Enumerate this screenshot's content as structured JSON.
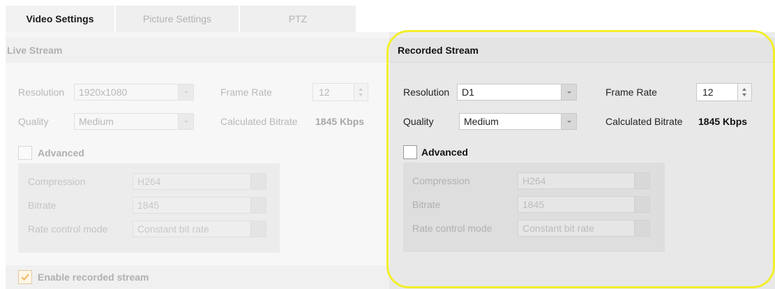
{
  "tabs": [
    {
      "label": "Video Settings",
      "active": true
    },
    {
      "label": "Picture Settings",
      "active": false
    },
    {
      "label": "PTZ",
      "active": false
    }
  ],
  "live_stream": {
    "title": "Live Stream",
    "resolution_label": "Resolution",
    "resolution_value": "1920x1080",
    "frame_rate_label": "Frame Rate",
    "frame_rate_value": "12",
    "quality_label": "Quality",
    "quality_value": "Medium",
    "calc_bitrate_label": "Calculated Bitrate",
    "calc_bitrate_value": "1845 Kbps",
    "advanced_label": "Advanced",
    "compression_label": "Compression",
    "compression_value": "H264",
    "bitrate_label": "Bitrate",
    "bitrate_value": "1845",
    "rate_control_label": "Rate control mode",
    "rate_control_value": "Constant bit rate",
    "enable_recorded_label": "Enable recorded stream",
    "enable_recorded_checked": true
  },
  "recorded_stream": {
    "title": "Recorded Stream",
    "resolution_label": "Resolution",
    "resolution_value": "D1",
    "frame_rate_label": "Frame Rate",
    "frame_rate_value": "12",
    "quality_label": "Quality",
    "quality_value": "Medium",
    "calc_bitrate_label": "Calculated Bitrate",
    "calc_bitrate_value": "1845 Kbps",
    "advanced_label": "Advanced",
    "compression_label": "Compression",
    "compression_value": "H264",
    "bitrate_label": "Bitrate",
    "bitrate_value": "1845",
    "rate_control_label": "Rate control mode",
    "rate_control_value": "Constant bit rate"
  },
  "colors": {
    "highlight": "#f2ef2a",
    "check_orange": "#f0a030"
  }
}
